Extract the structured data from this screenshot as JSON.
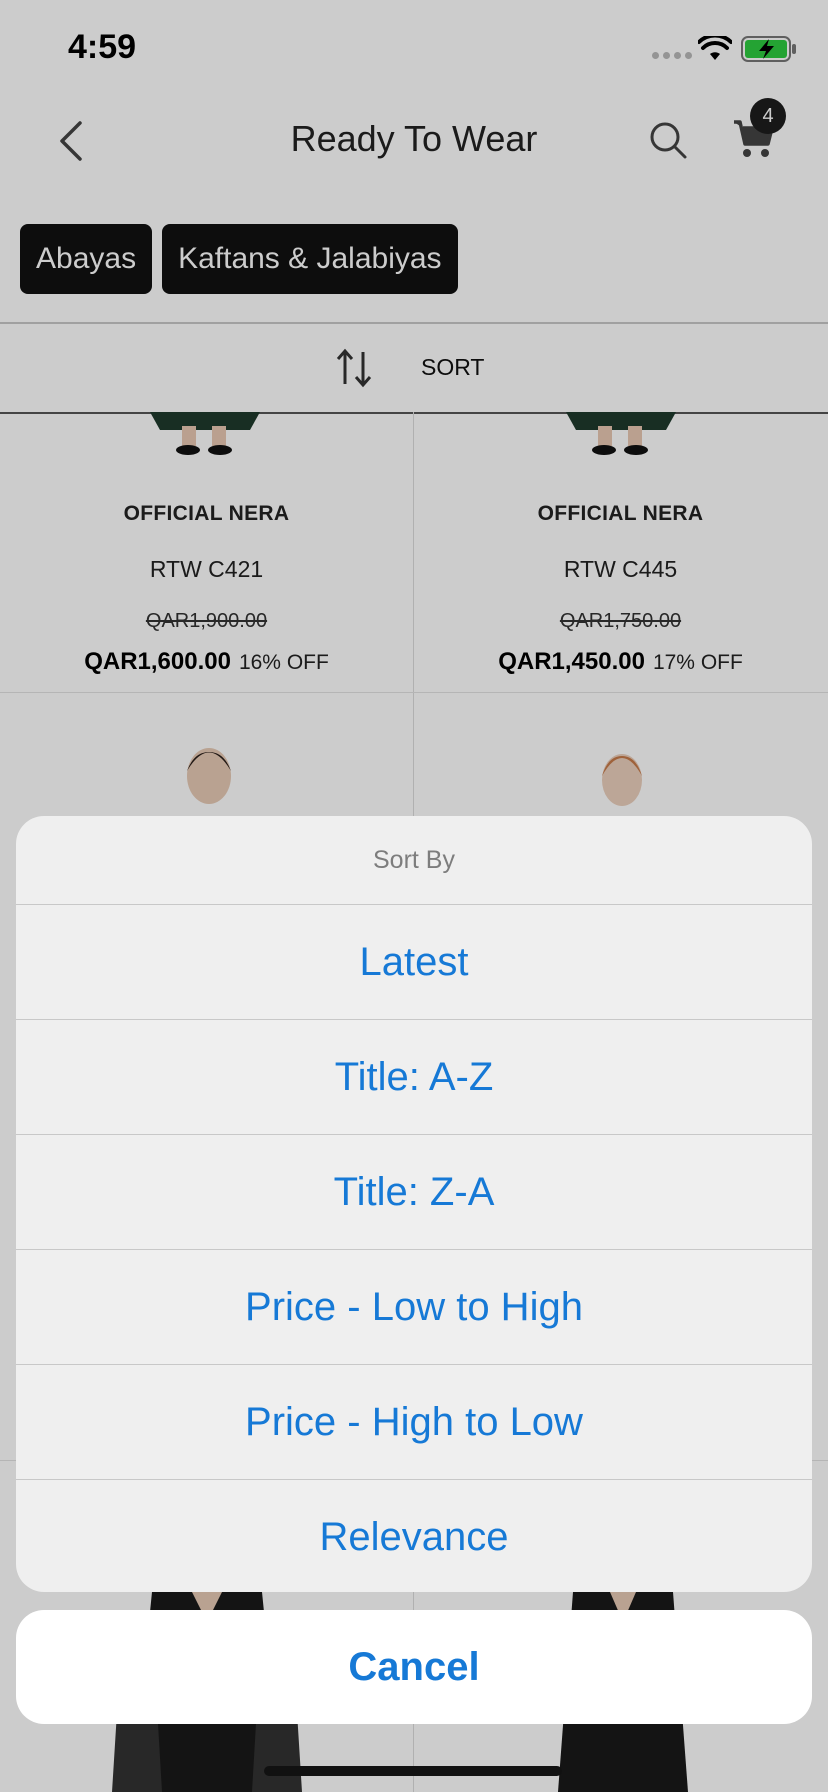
{
  "status_bar": {
    "time": "4:59"
  },
  "nav": {
    "title": "Ready To Wear",
    "cart_count": "4"
  },
  "chips": [
    "Abayas",
    "Kaftans & Jalabiyas"
  ],
  "sort_bar": {
    "label": "SORT"
  },
  "products": [
    {
      "brand": "OFFICIAL NERA",
      "name": "RTW C421",
      "original_price": "QAR1,900.00",
      "price": "QAR1,600.00",
      "discount": "16% OFF"
    },
    {
      "brand": "OFFICIAL NERA",
      "name": "RTW C445",
      "original_price": "QAR1,750.00",
      "price": "QAR1,450.00",
      "discount": "17% OFF"
    }
  ],
  "action_sheet": {
    "header": "Sort By",
    "options": [
      "Latest",
      "Title: A-Z",
      "Title: Z-A",
      "Price - Low to High",
      "Price - High to Low",
      "Relevance"
    ],
    "cancel_label": "Cancel"
  },
  "colors": {
    "action_blue": "#1679d6",
    "chip_bg": "#111111"
  }
}
